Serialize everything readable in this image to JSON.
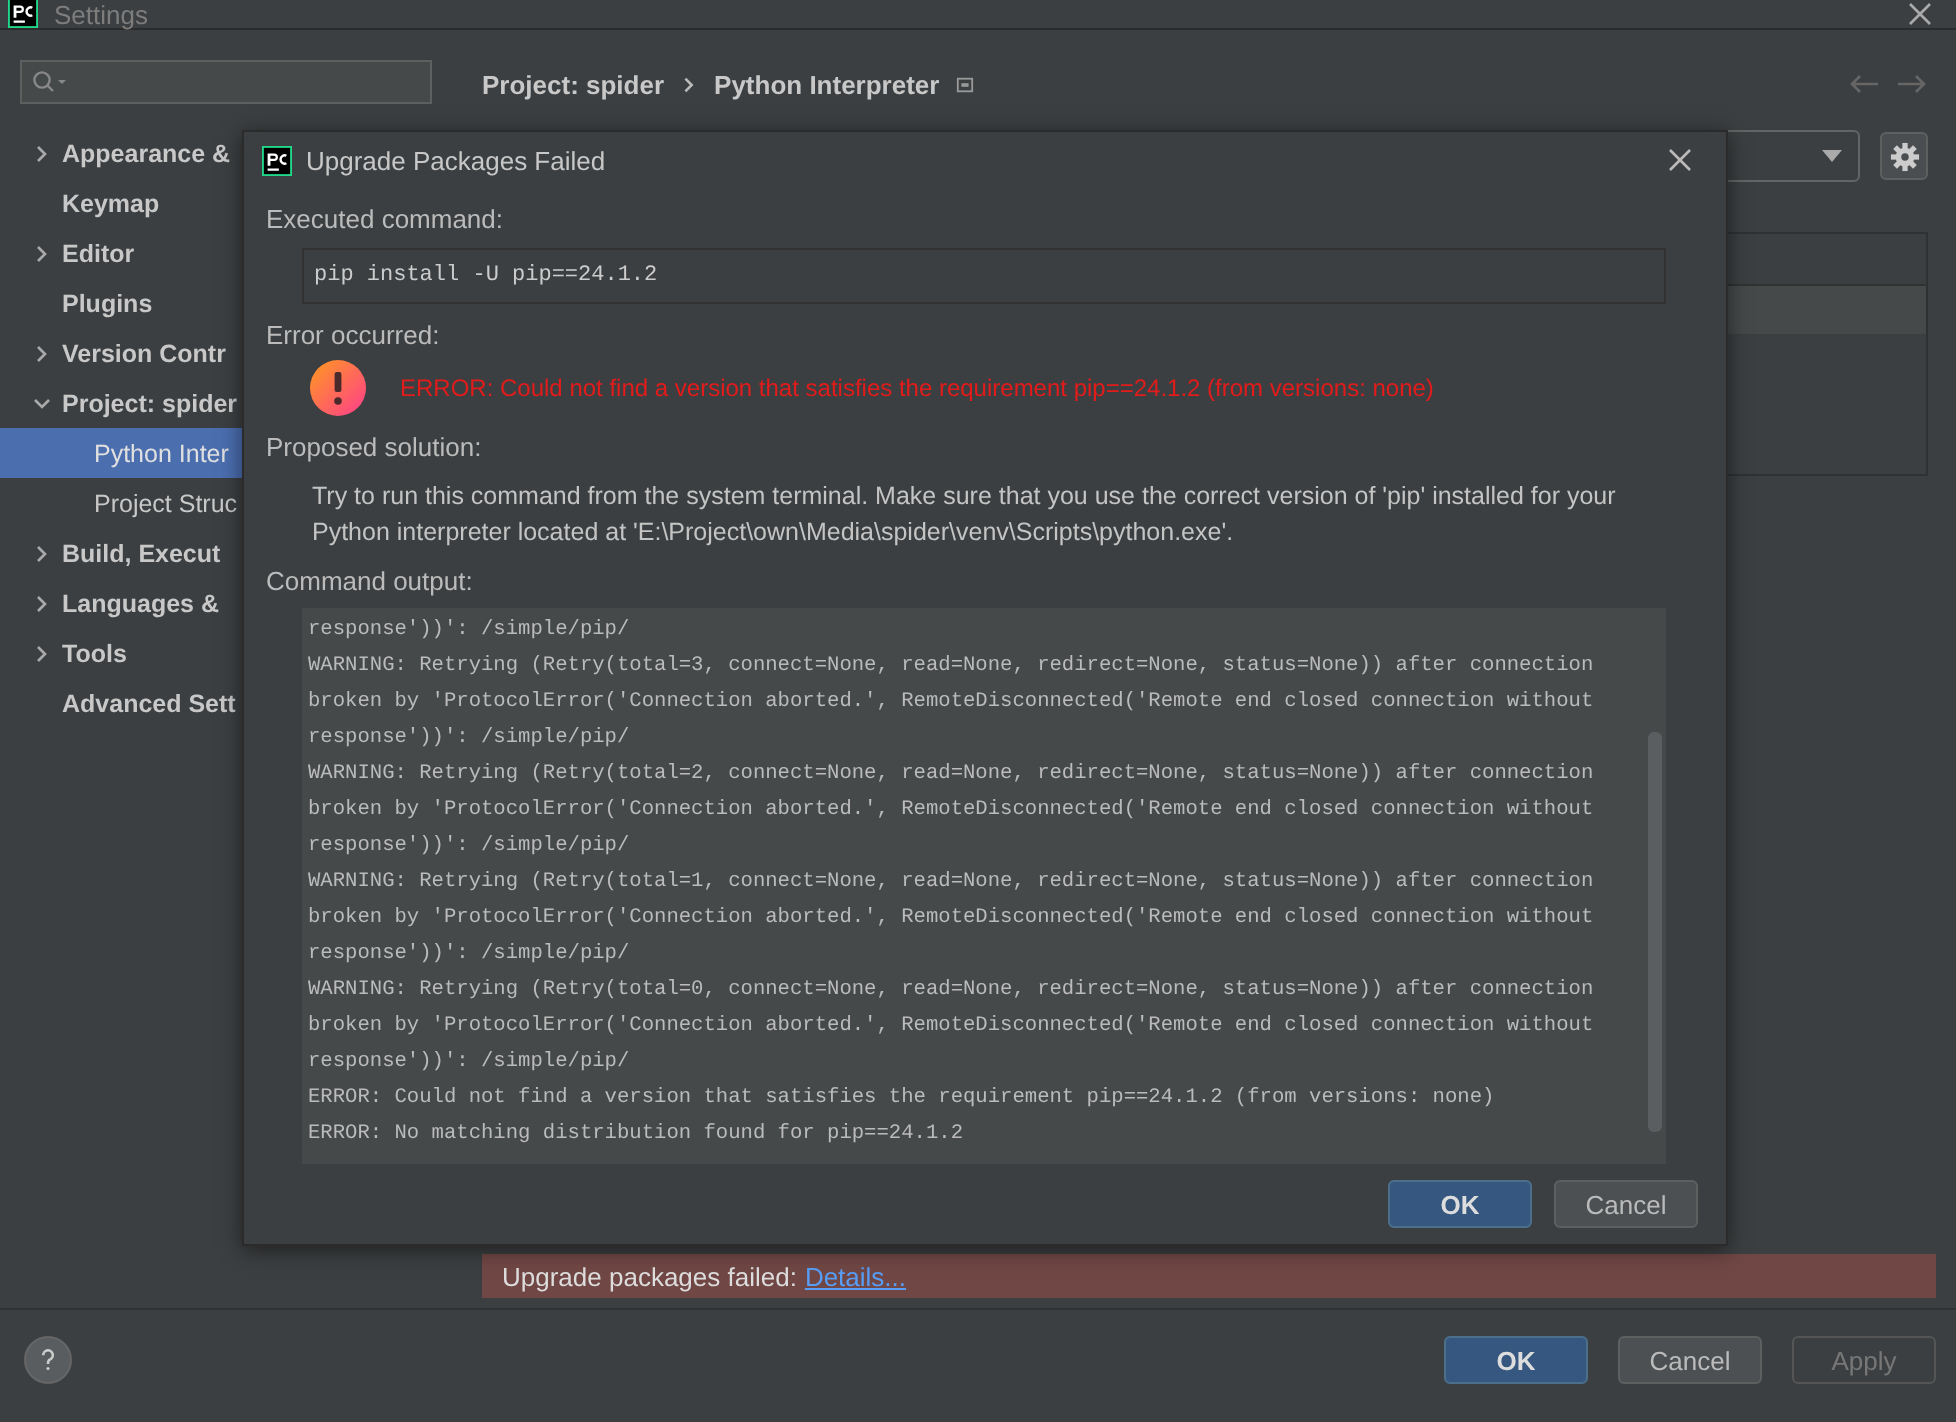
{
  "window": {
    "title": "Settings"
  },
  "sidebar": {
    "items": [
      {
        "label": "Appearance &",
        "expandable": true,
        "expanded": false,
        "selected": false
      },
      {
        "label": "Keymap",
        "expandable": false,
        "selected": false
      },
      {
        "label": "Editor",
        "expandable": true,
        "expanded": false,
        "selected": false
      },
      {
        "label": "Plugins",
        "expandable": false,
        "selected": false
      },
      {
        "label": "Version Contr",
        "expandable": true,
        "expanded": false,
        "selected": false
      },
      {
        "label": "Project: spider",
        "expandable": true,
        "expanded": true,
        "selected": false,
        "children": [
          {
            "label": "Python Inter",
            "selected": true
          },
          {
            "label": "Project Struc",
            "selected": false
          }
        ]
      },
      {
        "label": "Build, Execut",
        "expandable": true,
        "expanded": false,
        "selected": false
      },
      {
        "label": "Languages &",
        "expandable": true,
        "expanded": false,
        "selected": false
      },
      {
        "label": "Tools",
        "expandable": true,
        "expanded": false,
        "selected": false
      },
      {
        "label": "Advanced Sett",
        "expandable": false,
        "selected": false
      }
    ]
  },
  "breadcrumb": [
    "Project: spider",
    "Python Interpreter"
  ],
  "notification": {
    "text": "Upgrade packages failed:",
    "link": "Details..."
  },
  "footer_buttons": [
    {
      "label": "OK",
      "default": true,
      "disabled": false
    },
    {
      "label": "Cancel",
      "default": false,
      "disabled": false
    },
    {
      "label": "Apply",
      "default": false,
      "disabled": true
    }
  ],
  "dialog": {
    "title": "Upgrade Packages Failed",
    "executed_label": "Executed command:",
    "command": "pip install -U pip==24.1.2",
    "error_label": "Error occurred:",
    "error_message": "ERROR: Could not find a version that satisfies the requirement pip==24.1.2 (from versions: none)",
    "solution_label": "Proposed solution:",
    "solution_text": "Try to run this command from the system terminal. Make sure that you use the correct version of 'pip' installed for your Python interpreter located at 'E:\\Project\\own\\Media\\spider\\venv\\Scripts\\python.exe'.",
    "output_label": "Command output:",
    "output_lines": [
      "response'))': /simple/pip/",
      "WARNING: Retrying (Retry(total=3, connect=None, read=None, redirect=None, status=None)) after connection",
      "broken by 'ProtocolError('Connection aborted.', RemoteDisconnected('Remote end closed connection without",
      "response'))': /simple/pip/",
      "WARNING: Retrying (Retry(total=2, connect=None, read=None, redirect=None, status=None)) after connection",
      "broken by 'ProtocolError('Connection aborted.', RemoteDisconnected('Remote end closed connection without",
      "response'))': /simple/pip/",
      "WARNING: Retrying (Retry(total=1, connect=None, read=None, redirect=None, status=None)) after connection",
      "broken by 'ProtocolError('Connection aborted.', RemoteDisconnected('Remote end closed connection without",
      "response'))': /simple/pip/",
      "WARNING: Retrying (Retry(total=0, connect=None, read=None, redirect=None, status=None)) after connection",
      "broken by 'ProtocolError('Connection aborted.', RemoteDisconnected('Remote end closed connection without",
      "response'))': /simple/pip/",
      "ERROR: Could not find a version that satisfies the requirement pip==24.1.2 (from versions: none)",
      "ERROR: No matching distribution found for pip==24.1.2"
    ],
    "buttons": [
      {
        "label": "OK",
        "default": true
      },
      {
        "label": "Cancel",
        "default": false
      }
    ]
  }
}
